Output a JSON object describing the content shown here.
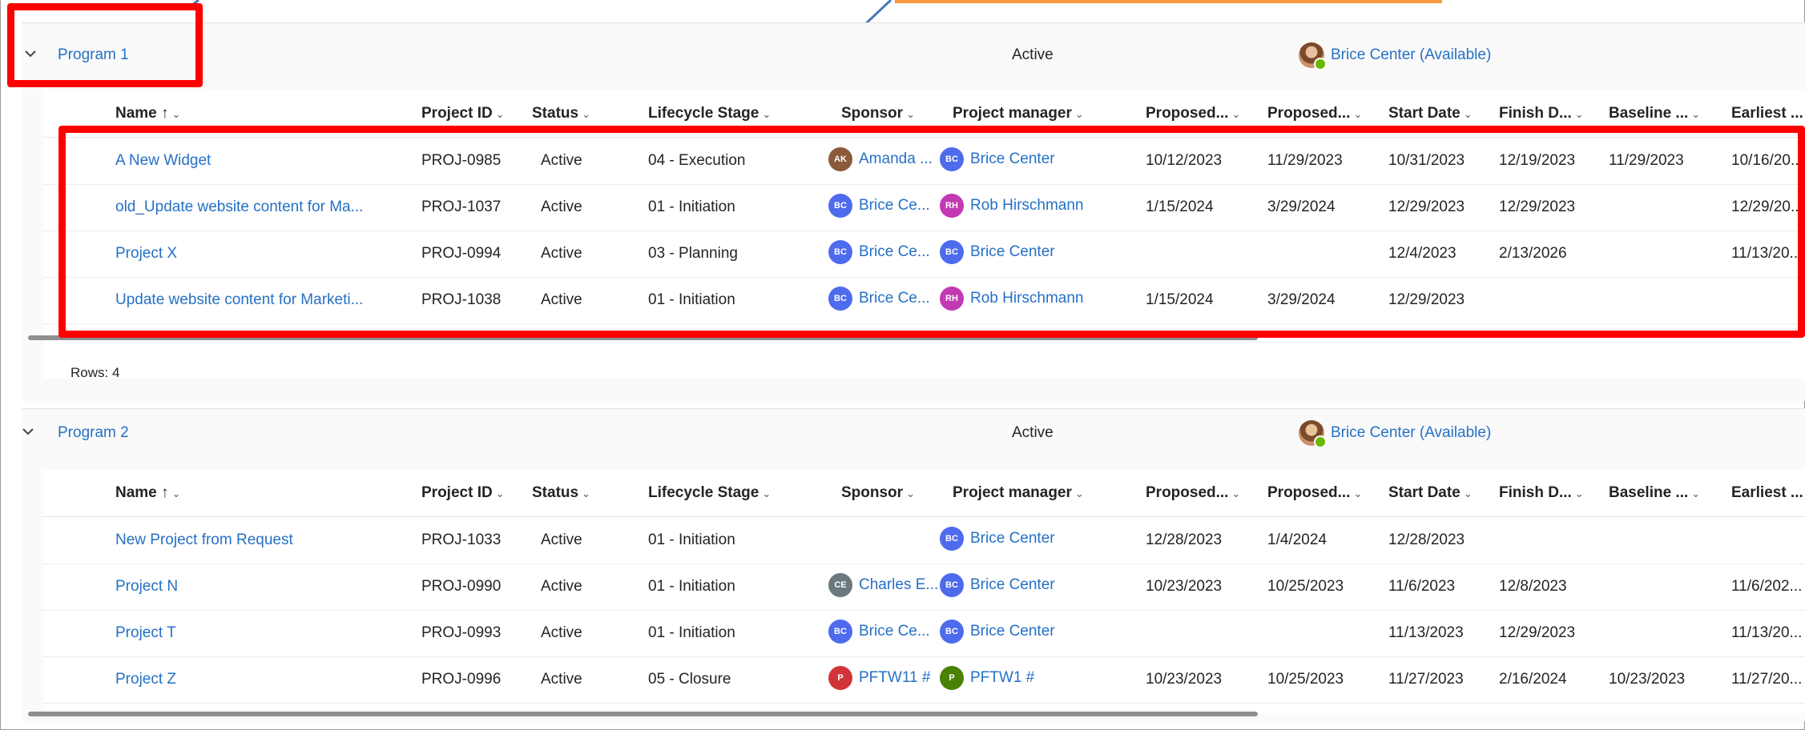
{
  "columns": {
    "name": "Name ↑",
    "project_id": "Project ID",
    "status": "Status",
    "lifecycle": "Lifecycle Stage",
    "sponsor": "Sponsor",
    "pm": "Project manager",
    "proposed_start": "Proposed...",
    "proposed_finish": "Proposed...",
    "start_date": "Start Date",
    "finish_date": "Finish D...",
    "baseline": "Baseline ...",
    "earliest": "Earliest ..."
  },
  "groups": [
    {
      "name": "Program 1",
      "status": "Active",
      "owner": "Brice Center (Available)",
      "rows_label": "Rows: 4",
      "rows": [
        {
          "name": "A New Widget",
          "id": "PROJ-0985",
          "status": "Active",
          "stage": "04 - Execution",
          "sponsor_initials": "AK",
          "sponsor": "Amanda ...",
          "pm_initials": "BC",
          "pm": "Brice Center",
          "p1": "10/12/2023",
          "p2": "11/29/2023",
          "start": "10/31/2023",
          "finish": "12/19/2023",
          "baseline": "11/29/2023",
          "earliest": "10/16/20..."
        },
        {
          "name": "old_Update website content for Ma...",
          "id": "PROJ-1037",
          "status": "Active",
          "stage": "01 - Initiation",
          "sponsor_initials": "BC",
          "sponsor": "Brice Ce...",
          "pm_initials": "RH",
          "pm": "Rob Hirschmann",
          "p1": "1/15/2024",
          "p2": "3/29/2024",
          "start": "12/29/2023",
          "finish": "12/29/2023",
          "baseline": "",
          "earliest": "12/29/20..."
        },
        {
          "name": "Project X",
          "id": "PROJ-0994",
          "status": "Active",
          "stage": "03 - Planning",
          "sponsor_initials": "BC",
          "sponsor": "Brice Ce...",
          "pm_initials": "BC",
          "pm": "Brice Center",
          "p1": "",
          "p2": "",
          "start": "12/4/2023",
          "finish": "2/13/2026",
          "baseline": "",
          "earliest": "11/13/20..."
        },
        {
          "name": "Update website content for Marketi...",
          "id": "PROJ-1038",
          "status": "Active",
          "stage": "01 - Initiation",
          "sponsor_initials": "BC",
          "sponsor": "Brice Ce...",
          "pm_initials": "RH",
          "pm": "Rob Hirschmann",
          "p1": "1/15/2024",
          "p2": "3/29/2024",
          "start": "12/29/2023",
          "finish": "",
          "baseline": "",
          "earliest": ""
        }
      ]
    },
    {
      "name": "Program 2",
      "status": "Active",
      "owner": "Brice Center (Available)",
      "rows": [
        {
          "name": "New Project from Request",
          "id": "PROJ-1033",
          "status": "Active",
          "stage": "01 - Initiation",
          "sponsor_initials": "",
          "sponsor": "",
          "pm_initials": "BC",
          "pm": "Brice Center",
          "p1": "12/28/2023",
          "p2": "1/4/2024",
          "start": "12/28/2023",
          "finish": "",
          "baseline": "",
          "earliest": ""
        },
        {
          "name": "Project N",
          "id": "PROJ-0990",
          "status": "Active",
          "stage": "01 - Initiation",
          "sponsor_initials": "CE",
          "sponsor": "Charles E...",
          "pm_initials": "BC",
          "pm": "Brice Center",
          "p1": "10/23/2023",
          "p2": "10/25/2023",
          "start": "11/6/2023",
          "finish": "12/8/2023",
          "baseline": "",
          "earliest": "11/6/202..."
        },
        {
          "name": "Project T",
          "id": "PROJ-0993",
          "status": "Active",
          "stage": "01 - Initiation",
          "sponsor_initials": "BC",
          "sponsor": "Brice Ce...",
          "pm_initials": "BC",
          "pm": "Brice Center",
          "p1": "",
          "p2": "",
          "start": "11/13/2023",
          "finish": "12/29/2023",
          "baseline": "",
          "earliest": "11/13/20..."
        },
        {
          "name": "Project Z",
          "id": "PROJ-0996",
          "status": "Active",
          "stage": "05 - Closure",
          "sponsor_initials": "P",
          "sponsor": "PFTW11 #",
          "pm_initials": "P",
          "pm": "PFTW1 #",
          "p1": "10/23/2023",
          "p2": "10/25/2023",
          "start": "11/27/2023",
          "finish": "2/16/2024",
          "baseline": "10/23/2023",
          "earliest": "11/27/20..."
        }
      ]
    }
  ],
  "colors": {
    "link": "#2570c5",
    "annotation_red": "#ff0000",
    "annotation_orange": "#f79a3e",
    "avatar_AK": "#8a5a3a",
    "avatar_BC": "#4f6bed",
    "avatar_RH": "#c239b3",
    "avatar_CE": "#69797e",
    "avatar_P_sponsor": "#d13438",
    "avatar_P_pm": "#498205"
  },
  "icons": [
    "chevron-down-icon",
    "sort-ascending-icon",
    "column-menu-caret-icon",
    "presence-available-icon"
  ]
}
